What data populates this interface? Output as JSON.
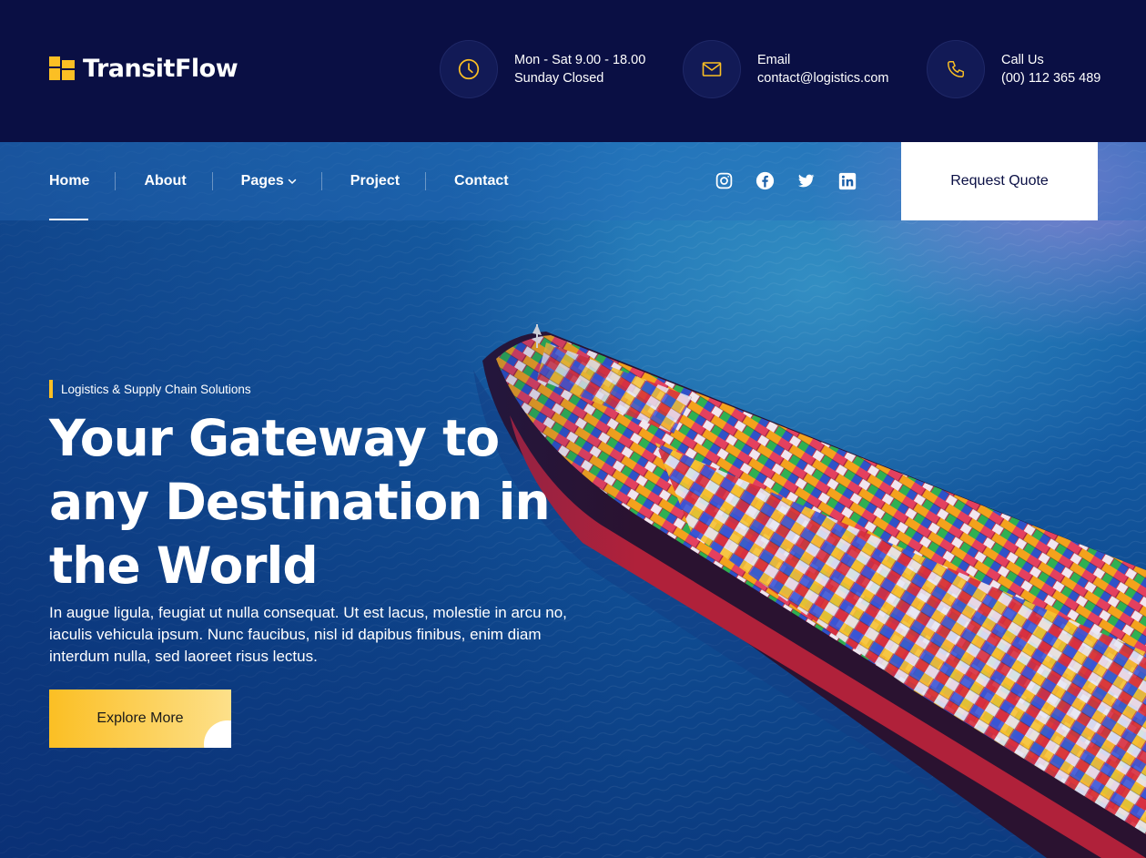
{
  "brand": {
    "name": "TransitFlow",
    "accent": "#fbbf24",
    "navy": "#0a0f44"
  },
  "contacts": [
    {
      "icon": "clock-icon",
      "line1": "Mon - Sat 9.00 - 18.00",
      "line2": "Sunday Closed"
    },
    {
      "icon": "mail-icon",
      "line1": "Email",
      "line2": "contact@logistics.com"
    },
    {
      "icon": "phone-icon",
      "line1": "Call Us",
      "line2": "(00) 112 365 489"
    }
  ],
  "nav": {
    "items": [
      {
        "label": "Home",
        "active": true
      },
      {
        "label": "About"
      },
      {
        "label": "Pages",
        "has_dropdown": true
      },
      {
        "label": "Project"
      },
      {
        "label": "Contact"
      }
    ],
    "socials": [
      "instagram-icon",
      "facebook-icon",
      "twitter-icon",
      "linkedin-icon"
    ],
    "cta": "Request Quote"
  },
  "hero": {
    "eyebrow": "Logistics & Supply Chain Solutions",
    "title_lines": [
      "Your Gateway to",
      "any Destination in",
      "the World"
    ],
    "description": "In augue ligula, feugiat ut nulla consequat. Ut est lacus, molestie in arcu no, iaculis vehicula ipsum. Nunc faucibus, nisl id dapibus finibus, enim diam interdum nulla, sed laoreet risus lectus.",
    "button": "Explore More"
  }
}
